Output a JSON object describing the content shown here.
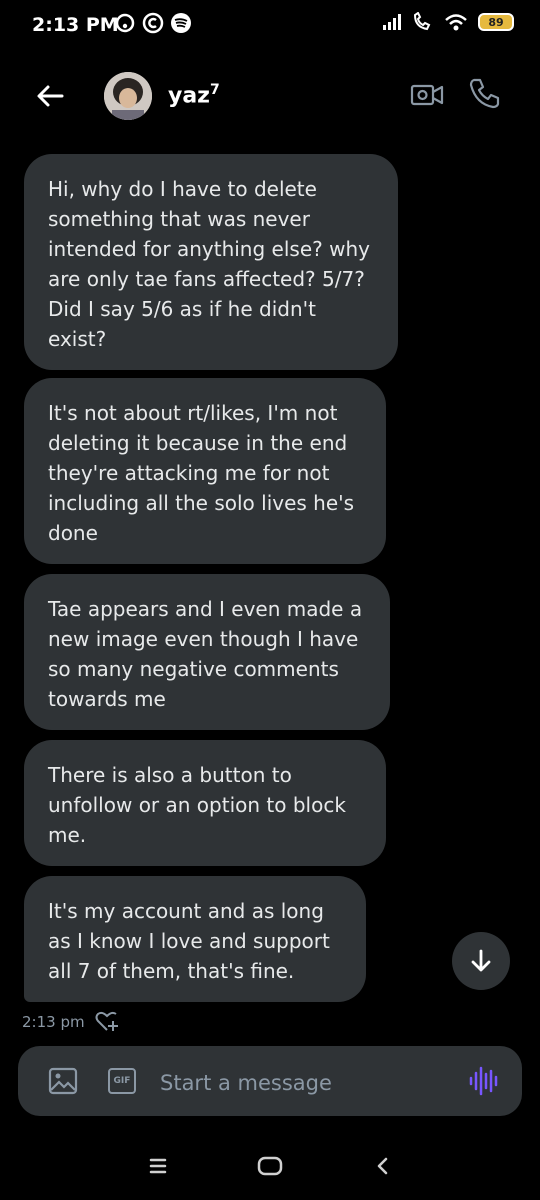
{
  "status_bar": {
    "time": "2:13 PM",
    "battery": "89",
    "left_icons": [
      "hotspot-icon",
      "circle-c-icon",
      "spotify-icon"
    ],
    "right_icons": [
      "signal-icon",
      "wifi-calling-icon",
      "wifi-icon",
      "battery-icon"
    ]
  },
  "header": {
    "name": "yaz",
    "name_superscript": "7",
    "icons": [
      "back-arrow-icon",
      "video-camera-icon",
      "phone-icon"
    ]
  },
  "messages": [
    {
      "text": "Hi, why do I have to delete something that was never intended for anything else? why are only tae fans affected? 5/7? Did I say 5/6 as if he didn't exist?"
    },
    {
      "text": "It's not about rt/likes, I'm not deleting it because in the end they're attacking me for not including all the solo lives he's done"
    },
    {
      "text": "Tae appears and I even made a new image even though I have so many negative comments towards me"
    },
    {
      "text": "There is also a button to unfollow or an option to block me."
    },
    {
      "text": "It's my account and as long as I know I love and support all 7 of them, that's fine."
    }
  ],
  "timestamp": "2:13 pm",
  "composer": {
    "placeholder": "Start a message",
    "gif_label": "GIF"
  },
  "colors": {
    "background": "#000000",
    "bubble": "#2f3336",
    "text": "#e7e9ea",
    "muted": "#8b98a5",
    "voice_accent": "#7856ff"
  }
}
